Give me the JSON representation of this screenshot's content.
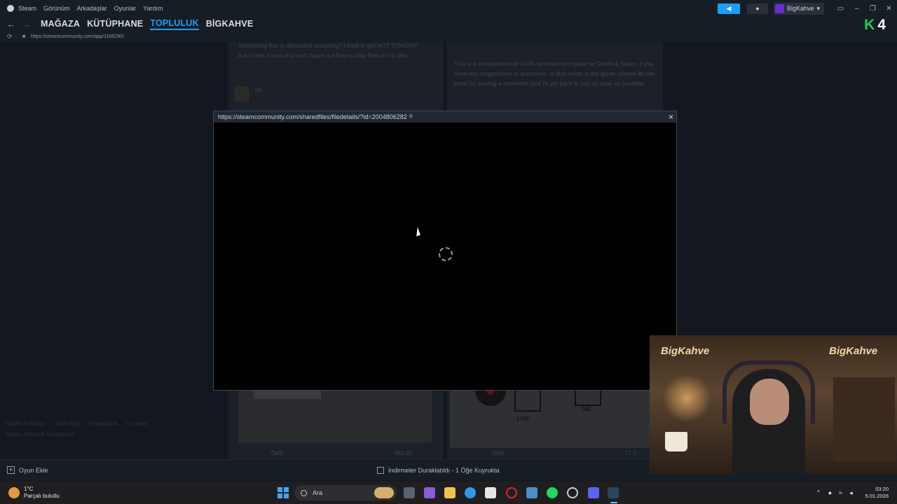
{
  "menubar": {
    "items": [
      "Steam",
      "Görünüm",
      "Arkadaşlar",
      "Oyunlar",
      "Yardım"
    ],
    "username": "BigKahve"
  },
  "nav": {
    "links": [
      "MAĞAZA",
      "KÜTÜPHANE",
      "TOPLULUK",
      "BİGKAHVE"
    ],
    "active_index": 2,
    "logo_k": "K",
    "logo_4": "4"
  },
  "address": {
    "url": "https://steamcommunity.com/app/1166290/"
  },
  "background": {
    "left_card_text": "Something that is document analyzing? I tried to get NOT TONIGHT but I have a mac and can't figure out how to play that on my Mac.",
    "left_card_user": "nix",
    "right_card_text": "This is a comprehensive 100% achievement guide for Death & Taxes. If you have any suggestions or questions, or find errors in the guide, please let me know by leaving a comment, and I'll get back to you as soon as possible.",
    "thumb_right_live": "LIVE",
    "thumb_right_die": "DIE",
    "left_foot_award": "Ödül",
    "left_foot_stats": "460  20",
    "right_foot_award": "Ödül",
    "right_foot_stats": "77  3",
    "footer_links": [
      "Gizlilik Politikası",
      "Yasal Bilgi",
      "Erişilebilirlik",
      "Çerezler"
    ],
    "footer_line2": "Steam Abonelik Sözleşmesi"
  },
  "modal": {
    "url": "https://steamcommunity.com/sharedfiles/filedetails/?id=2004806282",
    "close": "×"
  },
  "status": {
    "add_game": "Oyun Ekle",
    "downloads": "İndirmeler Duraklatıldı - 1 Öğe Kuyrukta"
  },
  "webcam": {
    "brand": "BigKahve"
  },
  "taskbar": {
    "temp": "1°C",
    "weather": "Parçalı bulutlu",
    "search_placeholder": "Ara",
    "time": "03:20",
    "date": "5.01.2026"
  },
  "colors": {
    "accent": "#1a9fff",
    "logo_green": "#1bd15c"
  }
}
